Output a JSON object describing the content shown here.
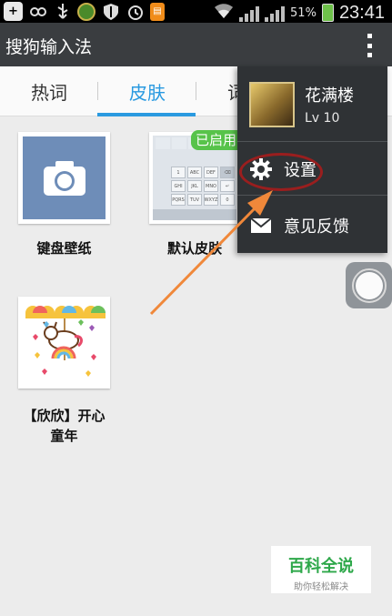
{
  "status_bar": {
    "battery_percent": "51%",
    "time": "23:41",
    "icons": [
      "plus-icon",
      "link-icon",
      "usb-icon",
      "app-coin-icon",
      "shield-icon",
      "alarm-icon",
      "notes-icon",
      "wifi-icon",
      "signal-icon",
      "battery-icon"
    ]
  },
  "app_bar": {
    "title": "搜狗输入法",
    "overflow_icon": "more-vert-icon"
  },
  "tabs": [
    {
      "label": "热词",
      "active": false
    },
    {
      "label": "皮肤",
      "active": true
    },
    {
      "label": "词"
    }
  ],
  "skins": [
    {
      "label": "键盘壁纸",
      "icon": "camera-icon"
    },
    {
      "label": "默认皮肤",
      "badge": "已启用"
    },
    {
      "label": "【欣欣】开心童年",
      "label_line1": "【欣欣】开心",
      "label_line2": "童年"
    }
  ],
  "menu": {
    "user": {
      "name": "花满楼",
      "level": "Lv 10"
    },
    "items": [
      {
        "label": "设置",
        "icon": "gear-icon"
      },
      {
        "label": "意见反馈",
        "icon": "mail-icon"
      }
    ]
  },
  "watermark": {
    "title": "百科全说",
    "subtitle": "助你轻松解决"
  },
  "colors": {
    "accent": "#2a9ae0",
    "app_bar": "#3a3d40",
    "badge_green": "#57c34a",
    "annotation_arrow": "#f0883a",
    "highlight_ring": "#9a1e1e"
  }
}
